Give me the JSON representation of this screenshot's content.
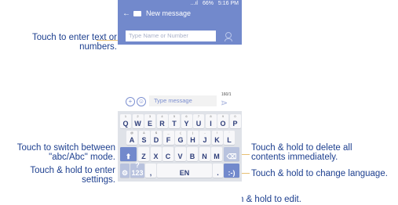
{
  "status": {
    "signal": "...ıl",
    "battery": "66%",
    "time": "5:16 PM"
  },
  "appbar": {
    "back_icon": "back-arrow-icon",
    "title": "New message"
  },
  "recipient": {
    "placeholder": "Type Name or Number"
  },
  "composer": {
    "placeholder": "Type message",
    "counter": "160/1",
    "emoji_icon": "☺",
    "add_icon": "+",
    "send_icon": "⋗"
  },
  "keyboard": {
    "row1": [
      {
        "hint": "1",
        "key": "Q"
      },
      {
        "hint": "2",
        "key": "W"
      },
      {
        "hint": "3",
        "key": "E"
      },
      {
        "hint": "4",
        "key": "R"
      },
      {
        "hint": "5",
        "key": "T"
      },
      {
        "hint": "6",
        "key": "Y"
      },
      {
        "hint": "7",
        "key": "U"
      },
      {
        "hint": "8",
        "key": "I"
      },
      {
        "hint": "9",
        "key": "O"
      },
      {
        "hint": "0",
        "key": "P"
      }
    ],
    "row2": [
      {
        "hint": "@",
        "key": "A"
      },
      {
        "hint": "&",
        "key": "S"
      },
      {
        "hint": "$",
        "key": "D"
      },
      {
        "hint": "_",
        "key": "F"
      },
      {
        "hint": "(",
        "key": "G"
      },
      {
        "hint": ")",
        "key": "H"
      },
      {
        "hint": "-",
        "key": "J"
      },
      {
        "hint": "!",
        "key": "K"
      },
      {
        "hint": "'",
        "key": "L"
      }
    ],
    "row3": [
      {
        "hint": "",
        "key": "Z"
      },
      {
        "hint": "",
        "key": "X"
      },
      {
        "hint": "",
        "key": "C"
      },
      {
        "hint": "",
        "key": "V"
      },
      {
        "hint": "",
        "key": "B"
      },
      {
        "hint": "",
        "key": "N"
      },
      {
        "hint": "",
        "key": "M"
      }
    ],
    "shift": "⬆",
    "delete": "⌫",
    "symbols": "?123",
    "settings": "⚙",
    "comma": ",",
    "space_label": "EN",
    "period": ".",
    "enter": ":-)"
  },
  "callouts": {
    "text_entry": "Touch to enter text or\nnumbers.",
    "switch_mode": "Touch to switch  between\n\"abc/Abc\" mode.",
    "settings": "Touch & hold to enter\nsettings.",
    "delete": "Touch & hold to delete all\ncontents immediately.",
    "language": "Touch & hold to change language.",
    "symbol": "Touch to enter symbol. Touch & hold to edit."
  }
}
